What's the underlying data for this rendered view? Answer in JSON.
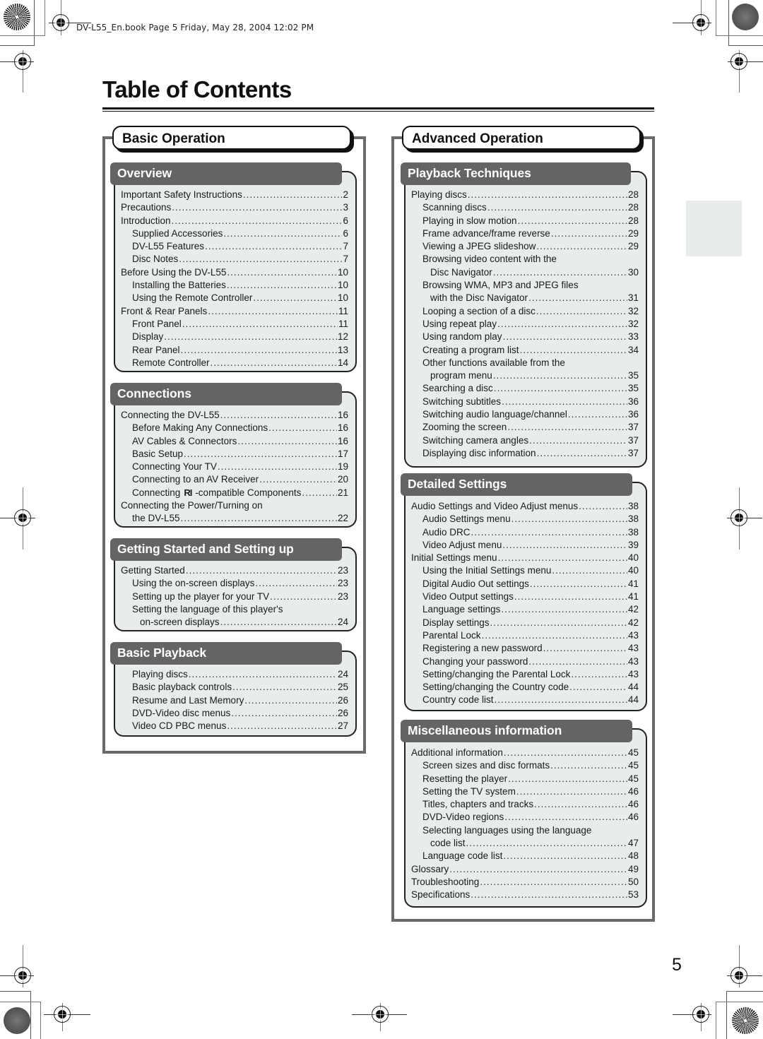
{
  "print_header": "DV-L55_En.book  Page 5  Friday, May 28, 2004  12:02 PM",
  "page_title": "Table of Contents",
  "page_number": "5",
  "colors": {
    "section_header_bg": "#646464",
    "section_box_bg": "#e8eceb",
    "column_frame": "#6a6a6a",
    "side_tab": "#e8ecea"
  },
  "columns": [
    {
      "title": "Basic Operation",
      "sections": [
        {
          "title": "Overview",
          "entries": [
            {
              "text": "Important Safety Instructions",
              "page": "2",
              "level": 0
            },
            {
              "text": "Precautions",
              "page": "3",
              "level": 0
            },
            {
              "text": "Introduction",
              "page": "6",
              "level": 0
            },
            {
              "text": "Supplied Accessories",
              "page": "6",
              "level": 1
            },
            {
              "text": "DV-L55 Features",
              "page": "7",
              "level": 1
            },
            {
              "text": "Disc Notes",
              "page": "7",
              "level": 1
            },
            {
              "text": "Before Using the DV-L55",
              "page": "10",
              "level": 0
            },
            {
              "text": "Installing the Batteries",
              "page": "10",
              "level": 1
            },
            {
              "text": "Using the Remote Controller",
              "page": "10",
              "level": 1
            },
            {
              "text": "Front & Rear Panels",
              "page": "11",
              "level": 0
            },
            {
              "text": "Front Panel",
              "page": "11",
              "level": 1
            },
            {
              "text": "Display",
              "page": "12",
              "level": 1
            },
            {
              "text": "Rear Panel",
              "page": "13",
              "level": 1
            },
            {
              "text": "Remote Controller",
              "page": "14",
              "level": 1
            }
          ]
        },
        {
          "title": "Connections",
          "entries": [
            {
              "text": "Connecting the DV-L55",
              "page": "16",
              "level": 0
            },
            {
              "text": "Before Making Any Connections",
              "page": "16",
              "level": 1
            },
            {
              "text": "AV Cables & Connectors",
              "page": "16",
              "level": 1
            },
            {
              "text": "Basic Setup",
              "page": "17",
              "level": 1
            },
            {
              "text": "Connecting Your TV",
              "page": "19",
              "level": 1
            },
            {
              "text": "Connecting to an AV Receiver",
              "page": "20",
              "level": 1
            },
            {
              "text": "Connecting",
              "logo": "RI",
              "text_after": "-compatible Components",
              "page": "21",
              "level": 1
            },
            {
              "text": "Connecting the Power/Turning on",
              "page": "",
              "level": 0
            },
            {
              "text": "the DV-L55",
              "page": "22",
              "level": 1
            }
          ]
        },
        {
          "title": "Getting Started and Setting up",
          "entries": [
            {
              "text": "Getting Started",
              "page": "23",
              "level": 0
            },
            {
              "text": "Using the on-screen displays",
              "page": "23",
              "level": 1
            },
            {
              "text": "Setting up the player for your TV",
              "page": "23",
              "level": 1
            },
            {
              "text": "Setting the language of this player's",
              "page": "",
              "level": 1
            },
            {
              "text": "on-screen displays",
              "page": "24",
              "level": 2
            }
          ]
        },
        {
          "title": "Basic Playback",
          "entries": [
            {
              "text": "Playing discs",
              "page": "24",
              "level": 1
            },
            {
              "text": "Basic playback controls",
              "page": "25",
              "level": 1
            },
            {
              "text": "Resume and Last Memory",
              "page": "26",
              "level": 1
            },
            {
              "text": "DVD-Video disc menus",
              "page": "26",
              "level": 1
            },
            {
              "text": "Video CD PBC menus",
              "page": "27",
              "level": 1
            }
          ]
        }
      ]
    },
    {
      "title": "Advanced Operation",
      "sections": [
        {
          "title": "Playback Techniques",
          "entries": [
            {
              "text": "Playing discs",
              "page": "28",
              "level": 0
            },
            {
              "text": "Scanning discs",
              "page": "28",
              "level": 1
            },
            {
              "text": "Playing in slow motion",
              "page": "28",
              "level": 1
            },
            {
              "text": "Frame advance/frame reverse",
              "page": "29",
              "level": 1
            },
            {
              "text": "Viewing a JPEG slideshow",
              "page": "29",
              "level": 1
            },
            {
              "text": "Browsing video content with the",
              "page": "",
              "level": 1
            },
            {
              "text": "Disc Navigator",
              "page": "30",
              "level": 2
            },
            {
              "text": "Browsing WMA, MP3 and JPEG files",
              "page": "",
              "level": 1
            },
            {
              "text": "with the Disc Navigator",
              "page": "31",
              "level": 2
            },
            {
              "text": "Looping a section of a disc",
              "page": "32",
              "level": 1
            },
            {
              "text": "Using repeat play",
              "page": "32",
              "level": 1
            },
            {
              "text": "Using random play",
              "page": "33",
              "level": 1
            },
            {
              "text": "Creating a program list",
              "page": "34",
              "level": 1
            },
            {
              "text": "Other functions available from the",
              "page": "",
              "level": 1
            },
            {
              "text": "program menu",
              "page": "35",
              "level": 2
            },
            {
              "text": "Searching a disc",
              "page": "35",
              "level": 1
            },
            {
              "text": "Switching subtitles",
              "page": "36",
              "level": 1
            },
            {
              "text": "Switching audio language/channel",
              "page": "36",
              "level": 1
            },
            {
              "text": "Zooming the screen",
              "page": "37",
              "level": 1
            },
            {
              "text": "Switching camera angles",
              "page": "37",
              "level": 1
            },
            {
              "text": "Displaying disc information",
              "page": "37",
              "level": 1
            }
          ]
        },
        {
          "title": "Detailed Settings",
          "entries": [
            {
              "text": "Audio Settings and Video Adjust menus",
              "page": "38",
              "level": 0
            },
            {
              "text": "Audio Settings menu",
              "page": "38",
              "level": 1
            },
            {
              "text": "Audio DRC",
              "page": "38",
              "level": 1
            },
            {
              "text": "Video Adjust menu",
              "page": "39",
              "level": 1
            },
            {
              "text": "Initial Settings menu",
              "page": "40",
              "level": 0
            },
            {
              "text": "Using the Initial Settings menu",
              "page": "40",
              "level": 1
            },
            {
              "text": "Digital Audio Out settings",
              "page": "41",
              "level": 1
            },
            {
              "text": "Video Output settings",
              "page": "41",
              "level": 1
            },
            {
              "text": "Language settings",
              "page": "42",
              "level": 1
            },
            {
              "text": "Display settings",
              "page": "42",
              "level": 1
            },
            {
              "text": "Parental Lock",
              "page": "43",
              "level": 1
            },
            {
              "text": "Registering a new password",
              "page": "43",
              "level": 1
            },
            {
              "text": "Changing your password",
              "page": "43",
              "level": 1
            },
            {
              "text": "Setting/changing the Parental Lock",
              "page": "43",
              "level": 1
            },
            {
              "text": "Setting/changing the Country code",
              "page": "44",
              "level": 1
            },
            {
              "text": "Country code list",
              "page": "44",
              "level": 1
            }
          ]
        },
        {
          "title": "Miscellaneous information",
          "entries": [
            {
              "text": "Additional information",
              "page": "45",
              "level": 0
            },
            {
              "text": "Screen sizes and disc formats",
              "page": "45",
              "level": 1
            },
            {
              "text": "Resetting the player",
              "page": "45",
              "level": 1
            },
            {
              "text": "Setting the TV system",
              "page": "46",
              "level": 1
            },
            {
              "text": "Titles, chapters and tracks",
              "page": "46",
              "level": 1
            },
            {
              "text": "DVD-Video regions",
              "page": "46",
              "level": 1
            },
            {
              "text": "Selecting languages using the language",
              "page": "",
              "level": 1
            },
            {
              "text": "code list",
              "page": "47",
              "level": 2
            },
            {
              "text": "Language code list",
              "page": "48",
              "level": 1
            },
            {
              "text": "Glossary",
              "page": "49",
              "level": 0
            },
            {
              "text": "Troubleshooting",
              "page": "50",
              "level": 0
            },
            {
              "text": "Specifications",
              "page": "53",
              "level": 0
            }
          ]
        }
      ]
    }
  ]
}
